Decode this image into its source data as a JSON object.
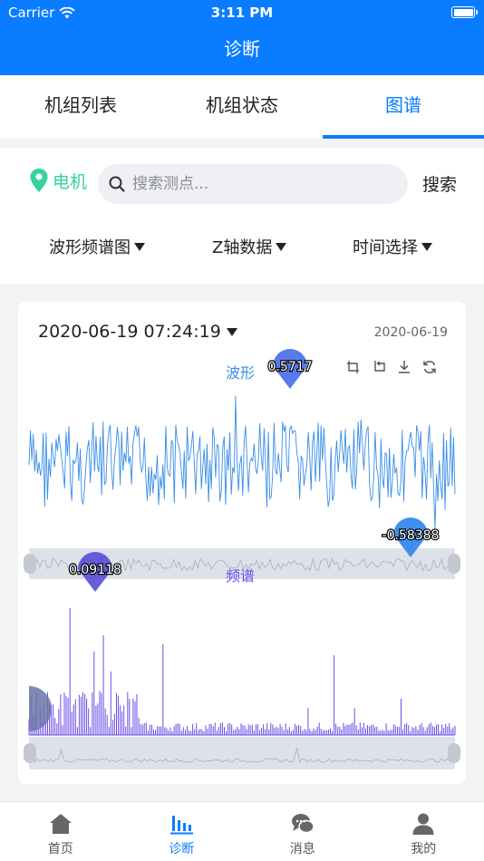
{
  "status": {
    "carrier": "Carrier",
    "time": "3:11 PM"
  },
  "nav": {
    "title": "诊断"
  },
  "tabs": [
    {
      "label": "机组列表",
      "active": false
    },
    {
      "label": "机组状态",
      "active": false
    },
    {
      "label": "图谱",
      "active": true
    }
  ],
  "filter": {
    "location": "电机",
    "search_placeholder": "搜索测点...",
    "search_button": "搜索",
    "dropdowns": [
      "波形频谱图",
      "Z轴数据",
      "时间选择"
    ]
  },
  "card": {
    "datetime": "2020-06-19 07:24:19",
    "date_small": "2020-06-19"
  },
  "chart_data": [
    {
      "type": "line",
      "title": "波形",
      "markers": [
        {
          "label": "0.5717",
          "kind": "max"
        },
        {
          "label": "-0.58388",
          "kind": "min"
        }
      ],
      "color": "#3a8ee6"
    },
    {
      "type": "bar",
      "title": "频谱",
      "markers": [
        {
          "label": "0.09118",
          "kind": "max"
        }
      ],
      "color": "#6b4ce6"
    }
  ],
  "tabbar": [
    {
      "label": "首页",
      "icon": "home-icon",
      "active": false
    },
    {
      "label": "诊断",
      "icon": "chart-icon",
      "active": true
    },
    {
      "label": "消息",
      "icon": "message-icon",
      "active": false
    },
    {
      "label": "我的",
      "icon": "user-icon",
      "active": false
    }
  ],
  "colors": {
    "primary": "#0a7cff",
    "location": "#34d39a",
    "wave": "#3a8ee6",
    "spectrum": "#6b4ce6"
  }
}
